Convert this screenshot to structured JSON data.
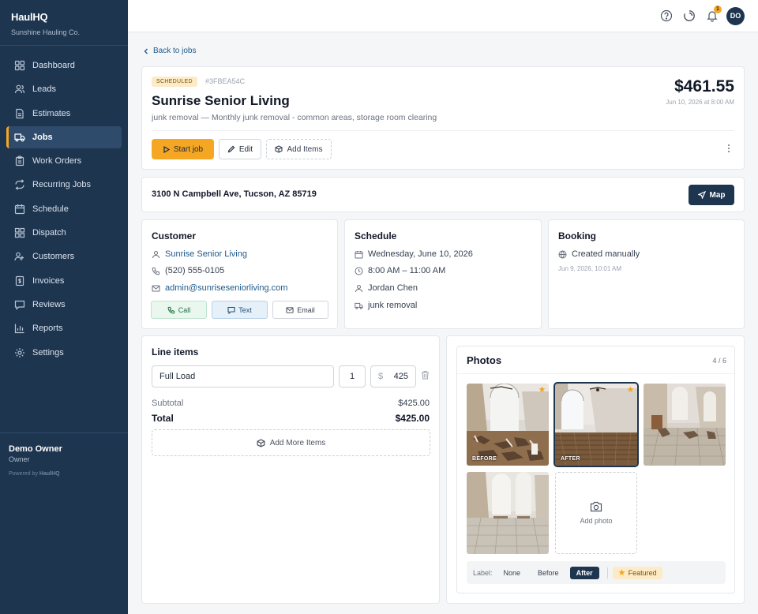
{
  "brand": {
    "name": "HaulHQ",
    "company": "Sunshine Hauling Co."
  },
  "nav": [
    {
      "label": "Dashboard",
      "icon": "dashboard-icon"
    },
    {
      "label": "Leads",
      "icon": "users-icon"
    },
    {
      "label": "Estimates",
      "icon": "document-icon"
    },
    {
      "label": "Jobs",
      "icon": "truck-icon",
      "active": true
    },
    {
      "label": "Work Orders",
      "icon": "clipboard-icon"
    },
    {
      "label": "Recurring Jobs",
      "icon": "repeat-icon"
    },
    {
      "label": "Schedule",
      "icon": "calendar-icon"
    },
    {
      "label": "Dispatch",
      "icon": "grid-icon"
    },
    {
      "label": "Customers",
      "icon": "user-group-icon"
    },
    {
      "label": "Invoices",
      "icon": "receipt-icon"
    },
    {
      "label": "Reviews",
      "icon": "message-icon"
    },
    {
      "label": "Reports",
      "icon": "bar-chart-icon"
    },
    {
      "label": "Settings",
      "icon": "gear-icon"
    }
  ],
  "owner": {
    "name": "Demo Owner",
    "role": "Owner",
    "powered_prefix": "Powered by",
    "powered_brand": "HaulHQ"
  },
  "topbar": {
    "notif_count": "1",
    "avatar_initials": "DO"
  },
  "back_label": "Back to jobs",
  "job": {
    "status": "SCHEDULED",
    "id": "#3FBEA54C",
    "title": "Sunrise Senior Living",
    "description": "junk removal — Monthly junk removal - common areas, storage room clearing",
    "price": "$461.55",
    "date": "Jun 10, 2026 at 8:00 AM",
    "start_label": "Start job",
    "edit_label": "Edit",
    "add_items_label": "Add Items"
  },
  "address": {
    "text": "3100 N Campbell Ave, Tucson, AZ 85719",
    "map_label": "Map"
  },
  "customer": {
    "title": "Customer",
    "name": "Sunrise Senior Living",
    "phone": "(520) 555-0105",
    "email": "admin@sunriseseniorliving.com",
    "call_label": "Call",
    "text_label": "Text",
    "email_label": "Email"
  },
  "schedule": {
    "title": "Schedule",
    "date": "Wednesday, June 10, 2026",
    "time": "8:00 AM – 11:00 AM",
    "crew": "Jordan Chen",
    "service": "junk removal"
  },
  "booking": {
    "title": "Booking",
    "method": "Created manually",
    "created": "Jun 9, 2026, 10:01 AM"
  },
  "line_items": {
    "title": "Line items",
    "items": [
      {
        "description": "Full Load",
        "qty": "1",
        "currency": "$",
        "price": "425"
      }
    ],
    "subtotal_label": "Subtotal",
    "subtotal": "$425.00",
    "total_label": "Total",
    "total": "$425.00",
    "add_more_label": "Add More Items"
  },
  "photos": {
    "title": "Photos",
    "count": "4 / 6",
    "items": [
      {
        "label": "BEFORE",
        "featured": true
      },
      {
        "label": "AFTER",
        "featured": true,
        "selected": true
      },
      {
        "label": ""
      },
      {
        "label": ""
      }
    ],
    "add_label": "Add photo",
    "label_prefix": "Label:",
    "label_options": [
      "None",
      "Before",
      "After"
    ],
    "label_selected": "After",
    "featured_label": "Featured"
  },
  "colors": {
    "sidebar": "#1e3550",
    "accent": "#f5a623",
    "link": "#1e5a8a"
  }
}
